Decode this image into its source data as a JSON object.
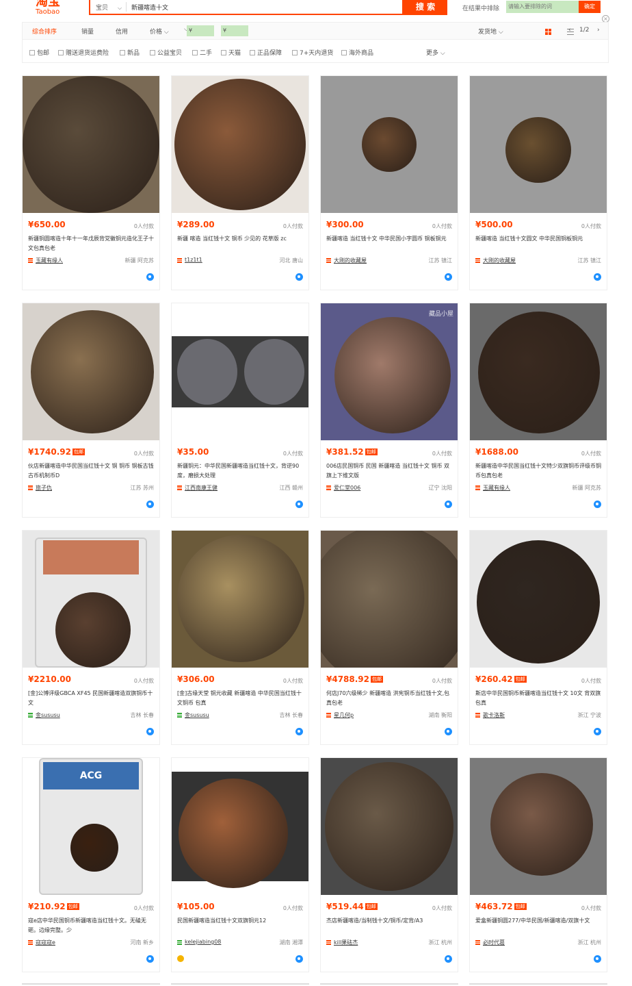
{
  "header": {
    "logo": "淘宝",
    "logo_sub": "Taobao",
    "search_type": "宝贝",
    "search_query": "新疆喀造十文",
    "search_button": "搜 索",
    "filter_label": "在结果中排除",
    "filter_placeholder": "请输入要排除的词",
    "filter_ok": "确定"
  },
  "sortbar": {
    "tabs": [
      "综合排序",
      "销量",
      "信用",
      "价格"
    ],
    "price_from": "¥",
    "price_to": "¥",
    "ship_from": "发货地",
    "page": "1/2"
  },
  "options": [
    "包邮",
    "赠送退货运费险",
    "新品",
    "公益宝贝",
    "二手",
    "天猫",
    "正品保障",
    "7+天内退货",
    "海外商品"
  ],
  "more": "更多",
  "products": [
    {
      "price": "¥650.00",
      "baoyou": false,
      "sales": "0人付款",
      "title": "新疆铜圆喀造十年十一年戊辰背党徽铜元造化王子十文包真包老",
      "shop": "玉藏有缘人",
      "location": "新疆 阿克苏"
    },
    {
      "price": "¥289.00",
      "baoyou": false,
      "sales": "0人付款",
      "title": "新疆 喀造 当红钱十文 铜币 少见的 花草版 zc",
      "shop": "t1z1t1",
      "location": "河北 唐山"
    },
    {
      "price": "¥300.00",
      "baoyou": false,
      "sales": "0人付款",
      "title": "新疆喀造 当红钱十文 中华民国小字圆币 铜板铜元",
      "shop": "大刚的收藏屋",
      "location": "江苏 镇江"
    },
    {
      "price": "¥500.00",
      "baoyou": false,
      "sales": "0人付款",
      "title": "新疆喀造 当红钱十文圆文 中华民国铜板铜元",
      "shop": "大刚的收藏屋",
      "location": "江苏 镇江"
    },
    {
      "price": "¥1740.92",
      "baoyou": true,
      "sales": "0人付款",
      "title": "伙店新疆喀造中华民国当红钱十文 铜 铜币 铜板古钱古币机制币D",
      "shop": "旅子仇",
      "location": "江苏 苏州"
    },
    {
      "price": "¥35.00",
      "baoyou": false,
      "sales": "0人付款",
      "title": "新疆铜元：中华民国新疆喀造当红钱十文，背逆90度，磨损大处理",
      "shop": "江西南康王健",
      "location": "江西 赣州"
    },
    {
      "price": "¥381.52",
      "baoyou": true,
      "sales": "0人付款",
      "title": "006店民国铜币 民国 新疆喀造 当红钱十文 铜币 双旗上下维文版",
      "shop": "爱仁堂006",
      "location": "辽宁 沈阳"
    },
    {
      "price": "¥1688.00",
      "baoyou": false,
      "sales": "0人付款",
      "title": "新疆喀造中华民国当红钱十文特少双旗铜币评级币铜币包真包老",
      "shop": "玉藏有缘人",
      "location": "新疆 阿克苏"
    },
    {
      "price": "¥2210.00",
      "baoyou": false,
      "sales": "0人付款",
      "title": "[金]公博评级GBCA XF45 民国新疆喀造双旗铜币十文",
      "shop": "金sususu",
      "location": "吉林 长春"
    },
    {
      "price": "¥306.00",
      "baoyou": false,
      "sales": "0人付款",
      "title": "[金]古缘天堂 铜元收藏 新疆喀造 中华民国当红钱十文铜币 包真",
      "shop": "金sususu",
      "location": "吉林 长春"
    },
    {
      "price": "¥4788.92",
      "baoyou": true,
      "sales": "0人付款",
      "title": "何店J70六级稀少 新疆喀造 洪宪铜币当红钱十文,包真包老",
      "shop": "星几何p",
      "location": "湖南 衡阳"
    },
    {
      "price": "¥260.42",
      "baoyou": true,
      "sales": "0人付款",
      "title": "斯店中华民国铜币新疆喀造当红钱十文 10文 背双旗 包真",
      "shop": "歌卡洛斯",
      "location": "浙江 宁波"
    },
    {
      "price": "¥210.92",
      "baoyou": true,
      "sales": "0人付款",
      "title": "寇e店中华民国铜币新疆喀造当红钱十文。无磕无砸。边缘完整。少",
      "shop": "寇寇寇e",
      "location": "河南 新乡"
    },
    {
      "price": "¥105.00",
      "baoyou": false,
      "sales": "0人付款",
      "title": "民国新疆喀造当红钱十文双旗铜元12",
      "shop": "kelejiabing08",
      "location": "湖南 湘潭"
    },
    {
      "price": "¥519.44",
      "baoyou": true,
      "sales": "0人付款",
      "title": "杰店新疆喀造/当制钱十文/铜币/定背/A3",
      "shop": "kill果砝杰",
      "location": "浙江 杭州"
    },
    {
      "price": "¥463.72",
      "baoyou": true,
      "sales": "0人付款",
      "title": "爱盒新疆铜圆277/中华民国/新疆喀造/双旗十文",
      "shop": "必时代葛",
      "location": "浙江 杭州"
    }
  ],
  "images": {
    "watermark_7": "藏品小屋",
    "acg_label": "ACG"
  },
  "colors": {
    "accent": "#ff4400",
    "link": "#1e90ff"
  }
}
